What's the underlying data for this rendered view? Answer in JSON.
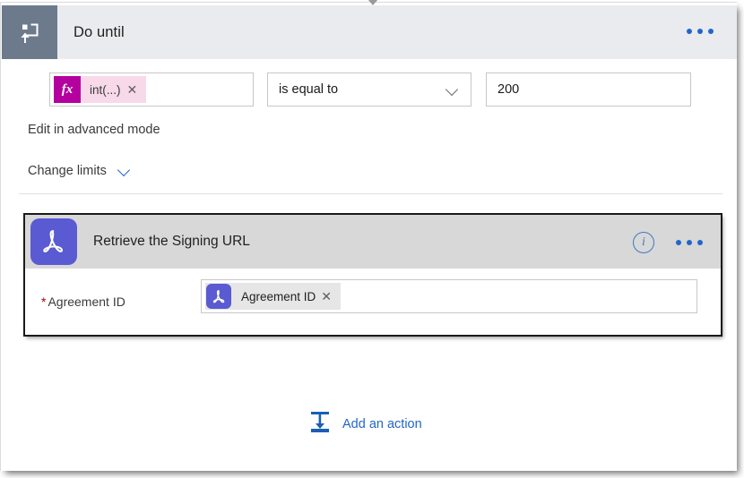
{
  "window": {
    "caret_icon": "caret-down-icon"
  },
  "loop": {
    "icon": "do-until-loop-icon",
    "title": "Do until",
    "menu_icon": "ellipsis-icon",
    "condition": {
      "left_token": {
        "badge": "fx",
        "label": "int(...)",
        "remove_icon": "close-icon"
      },
      "operator": "is equal to",
      "operator_chevron": "chevron-down-icon",
      "value": "200"
    },
    "advanced_link": "Edit in advanced mode",
    "limits_link": "Change limits",
    "limits_chevron": "chevron-down-icon"
  },
  "action": {
    "icon": "adobe-acrobat-sign-icon",
    "title": "Retrieve the Signing URL",
    "info_icon": "info-icon",
    "info_glyph": "i",
    "menu_icon": "ellipsis-icon",
    "field": {
      "required_marker": "*",
      "label": "Agreement ID",
      "token": {
        "icon": "adobe-acrobat-sign-icon",
        "label": "Agreement ID",
        "remove_icon": "close-icon"
      }
    }
  },
  "footer": {
    "add_action_icon": "insert-action-icon",
    "add_action_label": "Add an action"
  },
  "colors": {
    "accent_blue": "#2266c9",
    "header_bg": "#e9ebee",
    "loop_icon_bg": "#6c7a8c",
    "adobe_purple": "#5a5ad2",
    "expression_magenta": "#b4009e",
    "expression_token_bg": "#f7d9e9",
    "required_red": "#a80000",
    "action_header_bg": "#d8d8d8"
  }
}
